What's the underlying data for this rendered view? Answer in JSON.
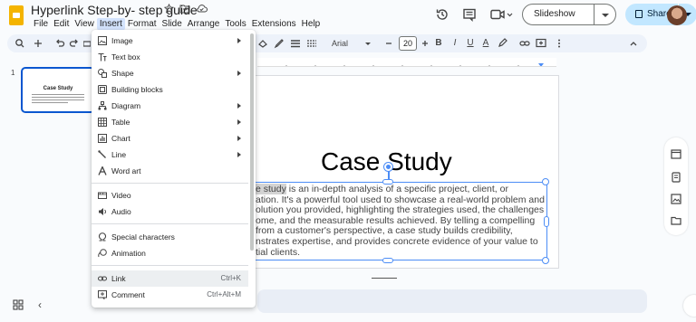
{
  "app": {
    "doc_title": "Hyperlink Step-by- step guide",
    "menus": [
      "File",
      "Edit",
      "View",
      "Insert",
      "Format",
      "Slide",
      "Arrange",
      "Tools",
      "Extensions",
      "Help"
    ],
    "active_menu": "Insert",
    "slideshow_label": "Slideshow",
    "share_label": "Share"
  },
  "toolbar": {
    "font": "Arial",
    "font_size": "20",
    "bold": "B",
    "italic": "I",
    "underline": "U",
    "text_color": "A"
  },
  "filmstrip": {
    "slide_number": "1",
    "thumb_title": "Case Study"
  },
  "slide": {
    "title": "Case Study",
    "body_highlight": "e study",
    "body_lines": [
      " is an in-depth analysis of a specific project, client, or",
      "ation. It's a powerful tool used to showcase a real-world problem and",
      "olution you provided, highlighting the strategies used, the challenges",
      "ome, and the measurable results achieved. By telling a compelling",
      "from a customer's perspective, a case study builds credibility,",
      "nstrates expertise, and provides concrete evidence of your value to",
      "tial clients."
    ]
  },
  "insert_menu": {
    "items": [
      {
        "label": "Image",
        "icon": "image-icon",
        "submenu": true
      },
      {
        "label": "Text box",
        "icon": "text-box-icon",
        "submenu": false
      },
      {
        "label": "Shape",
        "icon": "shape-icon",
        "submenu": true
      },
      {
        "label": "Building blocks",
        "icon": "building-blocks-icon",
        "submenu": false
      },
      {
        "label": "Diagram",
        "icon": "diagram-icon",
        "submenu": true
      },
      {
        "label": "Table",
        "icon": "table-icon",
        "submenu": true
      },
      {
        "label": "Chart",
        "icon": "chart-icon",
        "submenu": true
      },
      {
        "label": "Line",
        "icon": "line-icon",
        "submenu": true
      },
      {
        "label": "Word art",
        "icon": "word-art-icon",
        "submenu": false
      },
      {
        "label": "Video",
        "icon": "video-icon",
        "submenu": false
      },
      {
        "label": "Audio",
        "icon": "audio-icon",
        "submenu": false
      },
      {
        "label": "Special characters",
        "icon": "omega-icon",
        "submenu": false
      },
      {
        "label": "Animation",
        "icon": "animation-icon",
        "submenu": false
      },
      {
        "label": "Link",
        "icon": "link-icon",
        "shortcut": "Ctrl+K"
      },
      {
        "label": "Comment",
        "icon": "add-comment-icon",
        "shortcut": "Ctrl+Alt+M"
      }
    ]
  },
  "colors": {
    "accent": "#0b57d0",
    "selection": "#4c8df6",
    "share_bg": "#c2e7ff",
    "menu_hover": "#eceff1"
  }
}
